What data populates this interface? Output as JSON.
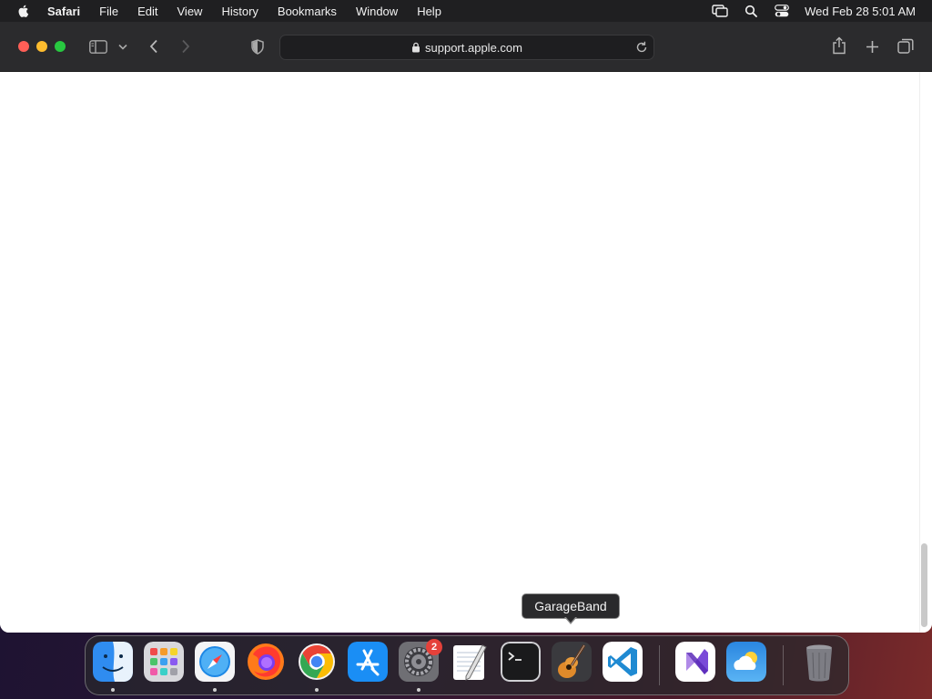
{
  "menubar": {
    "app": "Safari",
    "items": [
      "File",
      "Edit",
      "View",
      "History",
      "Bookmarks",
      "Window",
      "Help"
    ],
    "clock": "Wed Feb 28  5:01 AM"
  },
  "browser": {
    "url": "support.apple.com"
  },
  "tooltip": "GarageBand",
  "dock": {
    "settings_badge": "2",
    "icons": [
      "finder-icon",
      "launchpad-icon",
      "safari-icon",
      "firefox-icon",
      "chrome-icon",
      "app-store-icon",
      "system-settings-icon",
      "textedit-icon",
      "terminal-icon",
      "garageband-icon",
      "vscode-icon",
      "visual-studio-icon",
      "weather-icon",
      "trash-icon"
    ]
  },
  "colors": {
    "close": "#ff5f57",
    "minimize": "#febc2e",
    "zoom": "#28c840",
    "badge": "#e5413a"
  }
}
